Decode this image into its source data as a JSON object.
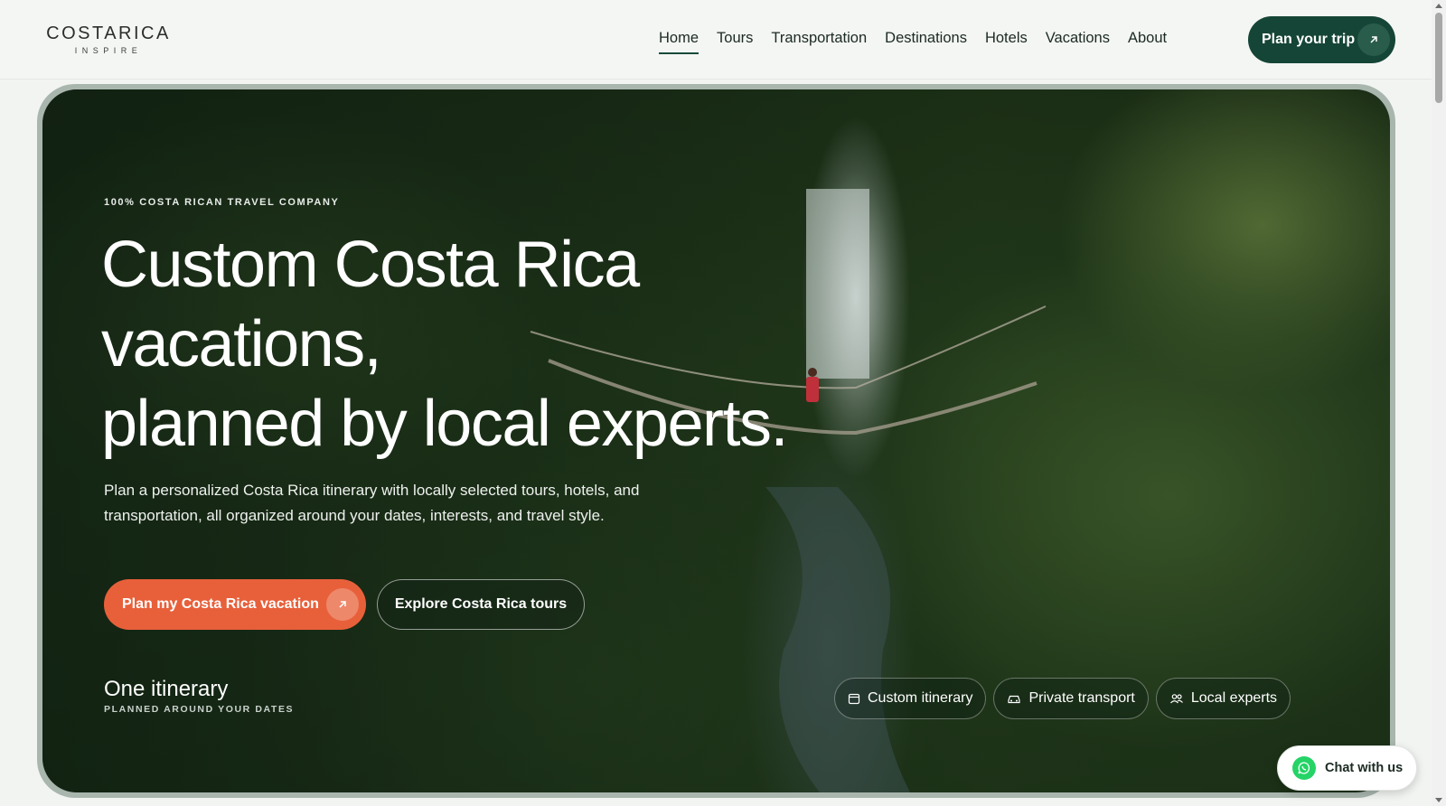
{
  "header": {
    "logo_main": "COSTARICA",
    "logo_sub": "INSPIRE",
    "nav": [
      {
        "label": "Home",
        "active": true
      },
      {
        "label": "Tours"
      },
      {
        "label": "Transportation"
      },
      {
        "label": "Destinations"
      },
      {
        "label": "Hotels"
      },
      {
        "label": "Vacations"
      },
      {
        "label": "About"
      }
    ],
    "cta_label": "Plan your trip",
    "cta_icon": "arrow-up-right-icon"
  },
  "hero": {
    "eyebrow": "100% COSTA RICAN TRAVEL COMPANY",
    "headline_lines": [
      "Custom Costa Rica",
      "vacations,",
      "planned by local experts."
    ],
    "lead": "Plan a personalized Costa Rica itinerary with locally selected tours, hotels, and transportation, all organized around your dates, interests, and travel style.",
    "primary_button": "Plan my Costa Rica vacation",
    "secondary_button": "Explore Costa Rica tours",
    "itinerary_title": "One itinerary",
    "itinerary_sub": "PLANNED AROUND YOUR DATES",
    "pills": [
      {
        "label": "Custom itinerary",
        "icon": "calendar-icon"
      },
      {
        "label": "Private transport",
        "icon": "car-icon"
      },
      {
        "label": "Local experts",
        "icon": "users-icon"
      }
    ]
  },
  "chat": {
    "label": "Chat with us",
    "icon": "whatsapp-icon"
  },
  "colors": {
    "brand_dark_green": "#154536",
    "accent_orange": "#e8603a"
  }
}
